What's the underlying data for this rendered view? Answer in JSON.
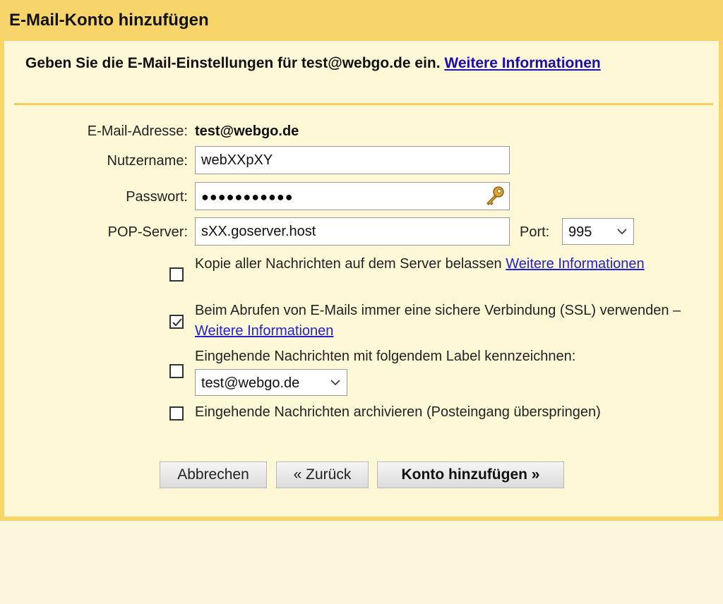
{
  "dialog": {
    "title": "E-Mail-Konto hinzufügen",
    "intro_text": "Geben Sie die E-Mail-Einstellungen für test@webgo.de ein. ",
    "intro_link": "Weitere Informationen"
  },
  "form": {
    "email_label": "E-Mail-Adresse:",
    "email_value": "test@webgo.de",
    "username_label": "Nutzername:",
    "username_value": "webXXpXY",
    "password_label": "Passwort:",
    "password_masked": "●●●●●●●●●●●",
    "pop_label": "POP-Server:",
    "pop_value": "sXX.goserver.host",
    "port_label": "Port:",
    "port_value": "995"
  },
  "options": {
    "keep_copy": {
      "checked": false,
      "text": "Kopie aller Nachrichten auf dem Server belassen ",
      "link": "Weitere Informationen"
    },
    "ssl": {
      "checked": true,
      "text": "Beim Abrufen von E-Mails immer eine sichere Verbindung (SSL) verwenden – ",
      "link": "Weitere Informationen"
    },
    "label": {
      "checked": false,
      "text": "Eingehende Nachrichten mit folgendem Label kennzeichnen:",
      "select_value": "test@webgo.de"
    },
    "archive": {
      "checked": false,
      "text": "Eingehende Nachrichten archivieren (Posteingang überspringen)"
    }
  },
  "buttons": {
    "cancel": "Abbrechen",
    "back": "« Zurück",
    "add": "Konto hinzufügen »"
  },
  "colors": {
    "header": "#f8d56b",
    "panel": "#fff8d7",
    "page": "#fdf6dc",
    "link": "#1a0dab"
  }
}
